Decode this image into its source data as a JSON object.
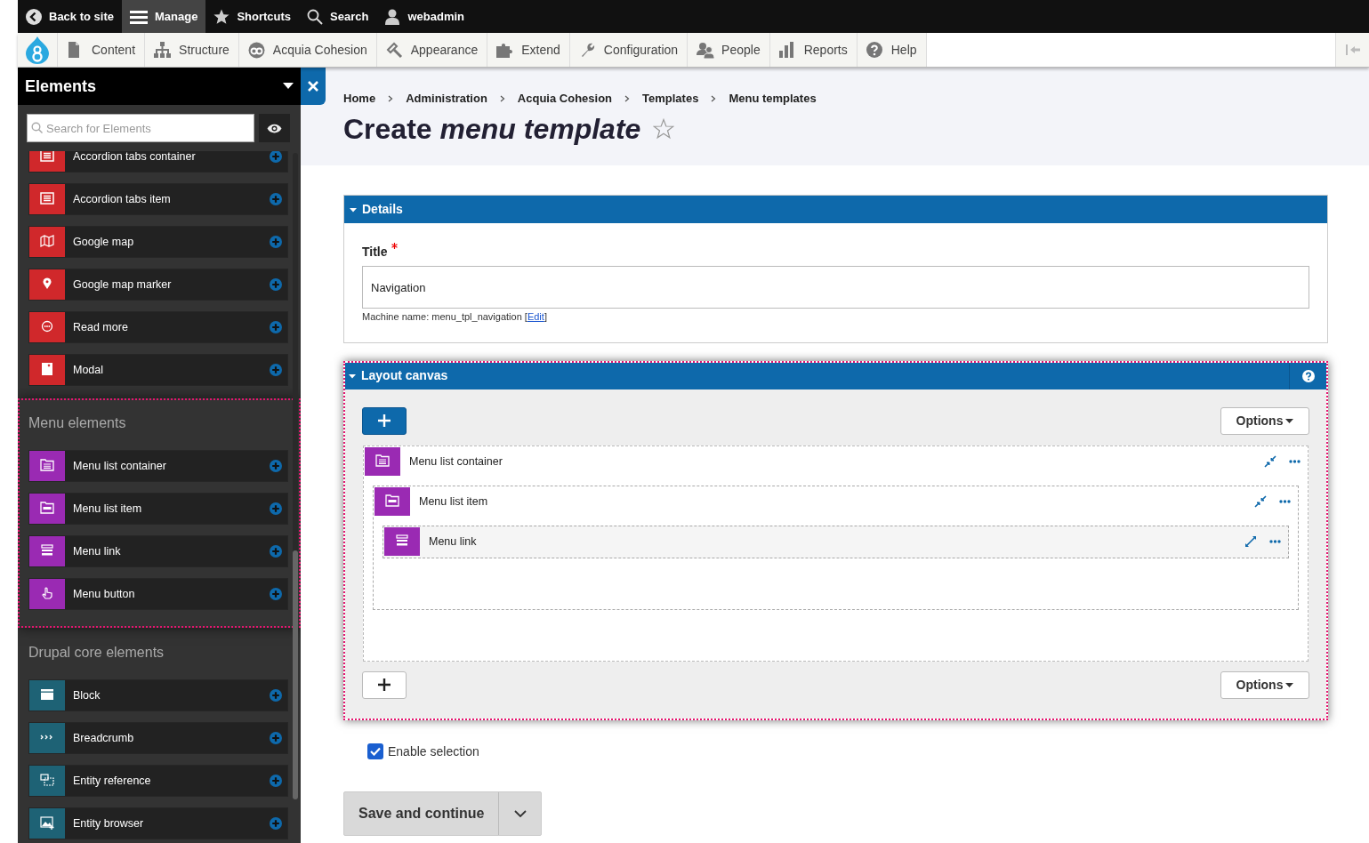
{
  "toolbar": {
    "items": [
      {
        "label": "Back to site",
        "kind": "back",
        "selected": false
      },
      {
        "label": "Manage",
        "kind": "menu",
        "selected": true
      },
      {
        "label": "Shortcuts",
        "kind": "star",
        "selected": false
      },
      {
        "label": "Search",
        "kind": "search",
        "selected": false
      },
      {
        "label": "webadmin",
        "kind": "user",
        "selected": false
      }
    ]
  },
  "admin_menu": {
    "items": [
      {
        "label": "Content",
        "kind": "content"
      },
      {
        "label": "Structure",
        "kind": "structure"
      },
      {
        "label": "Acquia Cohesion",
        "kind": "cohesion"
      },
      {
        "label": "Appearance",
        "kind": "appearance"
      },
      {
        "label": "Extend",
        "kind": "extend"
      },
      {
        "label": "Configuration",
        "kind": "configuration"
      },
      {
        "label": "People",
        "kind": "people"
      },
      {
        "label": "Reports",
        "kind": "reports"
      },
      {
        "label": "Help",
        "kind": "help"
      }
    ]
  },
  "sidebar": {
    "title": "Elements",
    "search": {
      "placeholder": "Search for Elements"
    },
    "groups": [
      {
        "color": "#d0282b",
        "highlighted": false,
        "items": [
          {
            "label": "Accordion tabs container",
            "kind": "panel"
          },
          {
            "label": "Accordion tabs item",
            "kind": "panel"
          },
          {
            "label": "Google map",
            "kind": "map"
          },
          {
            "label": "Google map marker",
            "kind": "marker"
          },
          {
            "label": "Read more",
            "kind": "more"
          },
          {
            "label": "Modal",
            "kind": "modal"
          }
        ]
      },
      {
        "title": "Menu elements",
        "color": "#9a2ab3",
        "highlighted": true,
        "items": [
          {
            "label": "Menu list container",
            "kind": "list"
          },
          {
            "label": "Menu list item",
            "kind": "folder"
          },
          {
            "label": "Menu link",
            "kind": "link"
          },
          {
            "label": "Menu button",
            "kind": "hand"
          }
        ]
      },
      {
        "title": "Drupal core elements",
        "color": "#1e6275",
        "highlighted": false,
        "items": [
          {
            "label": "Block",
            "kind": "block"
          },
          {
            "label": "Breadcrumb",
            "kind": "crumbs"
          },
          {
            "label": "Entity reference",
            "kind": "reference"
          },
          {
            "label": "Entity browser",
            "kind": "image"
          }
        ]
      }
    ]
  },
  "breadcrumb": [
    "Home",
    "Administration",
    "Acquia Cohesion",
    "Templates",
    "Menu templates"
  ],
  "page_title": "Create *menu template*",
  "details": {
    "title": "Details",
    "expanded": true,
    "field": {
      "label": "Title",
      "required": true,
      "value": "Navigation"
    },
    "machine_name_before": "Machine name: menu_tpl_navigation [",
    "edit_link": "Edit",
    "machine_name_after": "]"
  },
  "layout_canvas": {
    "title": "Layout canvas",
    "expanded": true,
    "highlighted": true,
    "top_options": "Options",
    "bottom_options": "Options",
    "tree": [
      {
        "label": "Menu list container",
        "kind": "list",
        "expanded": true,
        "children": [
          {
            "label": "Menu list item",
            "kind": "folder",
            "expanded": true,
            "children": [
              {
                "label": "Menu link",
                "kind": "link",
                "expanded": false
              }
            ]
          }
        ]
      }
    ]
  },
  "enable_selection": {
    "label": "Enable selection",
    "checked": true
  },
  "save_button": {
    "label": "Save and continue"
  }
}
